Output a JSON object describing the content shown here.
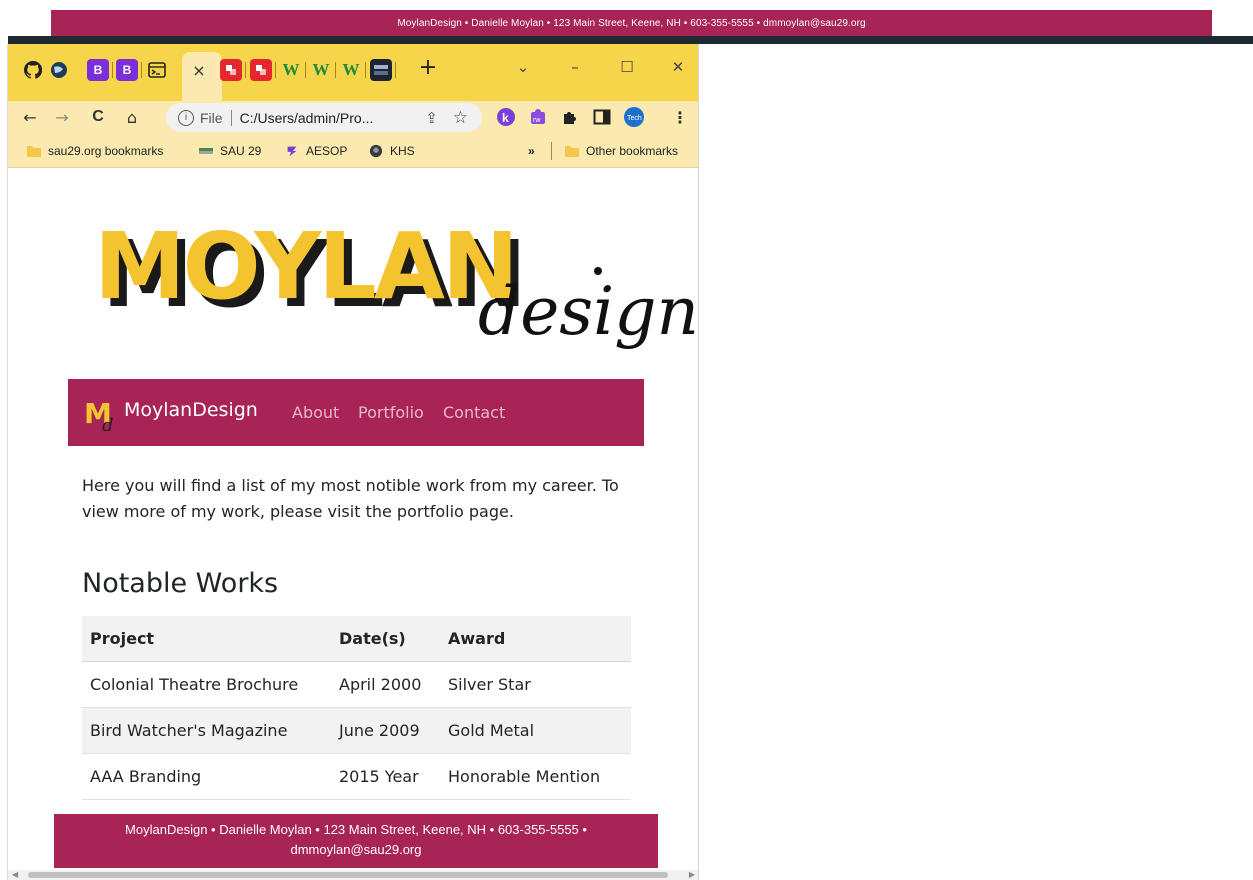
{
  "background": {
    "footer_text": "MoylanDesign • Danielle Moylan • 123 Main Street, Keene, NH • 603-355-5555 • dmmoylan@sau29.org"
  },
  "browser": {
    "tabs": [
      {
        "icon": "github-icon",
        "label": ""
      },
      {
        "icon": "globe-icon",
        "label": ""
      },
      {
        "icon": "bootstrap-icon",
        "label": "B"
      },
      {
        "icon": "bootstrap-icon",
        "label": "B"
      },
      {
        "icon": "terminal-icon",
        "label": ""
      },
      {
        "icon": "close-icon",
        "label": "×"
      },
      {
        "icon": "red-square-icon",
        "label": ""
      },
      {
        "icon": "red-square-icon",
        "label": ""
      },
      {
        "icon": "w-icon",
        "label": "W"
      },
      {
        "icon": "w-icon",
        "label": "W"
      },
      {
        "icon": "w-icon",
        "label": "W"
      },
      {
        "icon": "screen-icon",
        "label": ""
      }
    ],
    "new_tab": "+",
    "window_controls": {
      "dropdown": "⌄",
      "minimize": "–",
      "maximize": "☐",
      "close": "✕"
    },
    "toolbar": {
      "back": "←",
      "forward": "→",
      "reload": "C",
      "home": "⌂",
      "info": "i",
      "file_label": "File",
      "url": "C:/Users/admin/Pro...",
      "share": "⇪",
      "star": "☆",
      "more": "⋮"
    },
    "bookmarks": [
      {
        "icon": "folder-icon",
        "label": "sau29.org bookmarks"
      },
      {
        "icon": "flag-icon",
        "label": "SAU 29"
      },
      {
        "icon": "aesop-icon",
        "label": "AESOP"
      },
      {
        "icon": "khs-icon",
        "label": "KHS"
      }
    ],
    "bookmarks_overflow": "»",
    "other_bookmarks": "Other bookmarks"
  },
  "page": {
    "logo_text_main": "MOYLAN",
    "logo_text_script": "design",
    "navbar": {
      "brand_mark": "M",
      "brand_mark_sub": "d",
      "brand": "MoylanDesign",
      "links": [
        "About",
        "Portfolio",
        "Contact"
      ]
    },
    "intro": "Here you will find a list of my most notible work from my career. To view more of my work, please visit the portfolio page.",
    "section_title": "Notable Works",
    "table": {
      "headers": [
        "Project",
        "Date(s)",
        "Award"
      ],
      "rows": [
        [
          "Colonial Theatre Brochure",
          "April 2000",
          "Silver Star"
        ],
        [
          "Bird Watcher's Magazine",
          "June 2009",
          "Gold Metal"
        ],
        [
          "AAA Branding",
          "2015 Year",
          "Honorable Mention"
        ]
      ]
    },
    "footer_line1": "MoylanDesign • Danielle Moylan • 123 Main Street, Keene, NH • 603-355-5555 •",
    "footer_line2": "dmmoylan@sau29.org"
  },
  "colors": {
    "brand": "#a82457",
    "logo_yellow": "#f4c430",
    "tabstrip": "#f7d54a",
    "toolbar": "#fbeab0"
  }
}
